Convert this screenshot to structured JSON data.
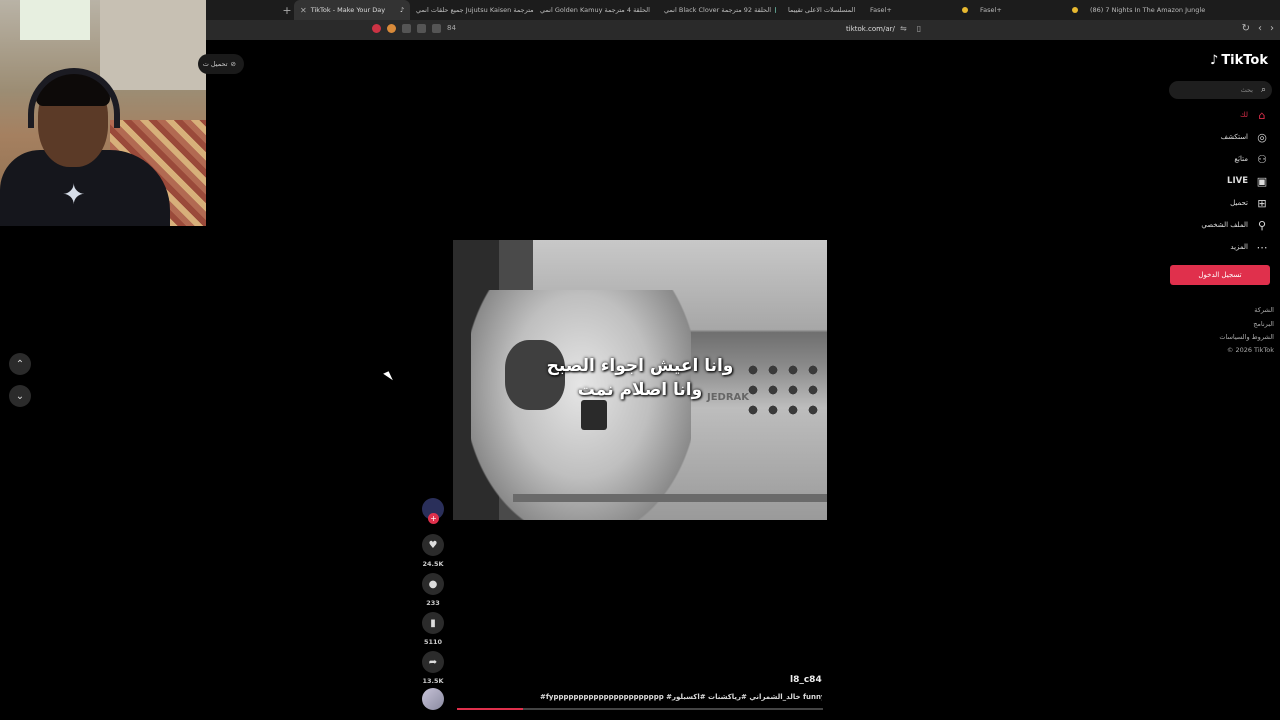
{
  "browser": {
    "new_tab_label": "+",
    "tabs": [
      {
        "title": "TikTok - Make Your Day",
        "active": true
      },
      {
        "title": "جميع حلقات انمي Jujutsu Kaisen مترجمة"
      },
      {
        "title": "انمي Golden Kamuy الحلقة 4 مترجمة"
      },
      {
        "title": "انمي Black Clover الحلقة 92 مترجمة"
      },
      {
        "title": "المسلسلات الاعلى تقييما"
      },
      {
        "title": "Fasel+"
      },
      {
        "title": "Fasel+"
      },
      {
        "title": "(86) 7 Nights In The Amazon Jungle"
      }
    ],
    "url": "tiktok.com/ar/",
    "tab_counter": "84"
  },
  "page": {
    "get_app_label": "تحميل ت",
    "video": {
      "caption_line1": "وانا اعيش اجواء الصبح",
      "caption_line2": "وانا اصلام نمت",
      "watermark": "JEDRAK",
      "username": "l8_c84",
      "description": "#fypppppppppppppppppppppp #خالد_الشمراني #رياكشنات #اكسبلور funny# explore",
      "progress": 0.18
    },
    "actions": {
      "likes": "24.5K",
      "comments": "233",
      "saves": "5110",
      "shares": "13.5K"
    }
  },
  "sidebar": {
    "brand": "TikTok",
    "search_placeholder": "بحث",
    "items": [
      {
        "label": "لك",
        "icon": "home-icon",
        "active": true
      },
      {
        "label": "استكشف",
        "icon": "compass-icon"
      },
      {
        "label": "متابَع",
        "icon": "following-icon"
      },
      {
        "label": "LIVE",
        "icon": "live-icon"
      },
      {
        "label": "تحميل",
        "icon": "upload-icon"
      },
      {
        "label": "الملف الشخصي",
        "icon": "profile-icon"
      },
      {
        "label": "المزيد",
        "icon": "more-icon"
      }
    ],
    "login_label": "تسجيل الدخول",
    "footer": [
      "الشركة",
      "البرنامج",
      "الشروط والسياسات",
      "© 2026 TikTok"
    ]
  },
  "colors": {
    "accent": "#e0304c",
    "background": "#000000"
  }
}
